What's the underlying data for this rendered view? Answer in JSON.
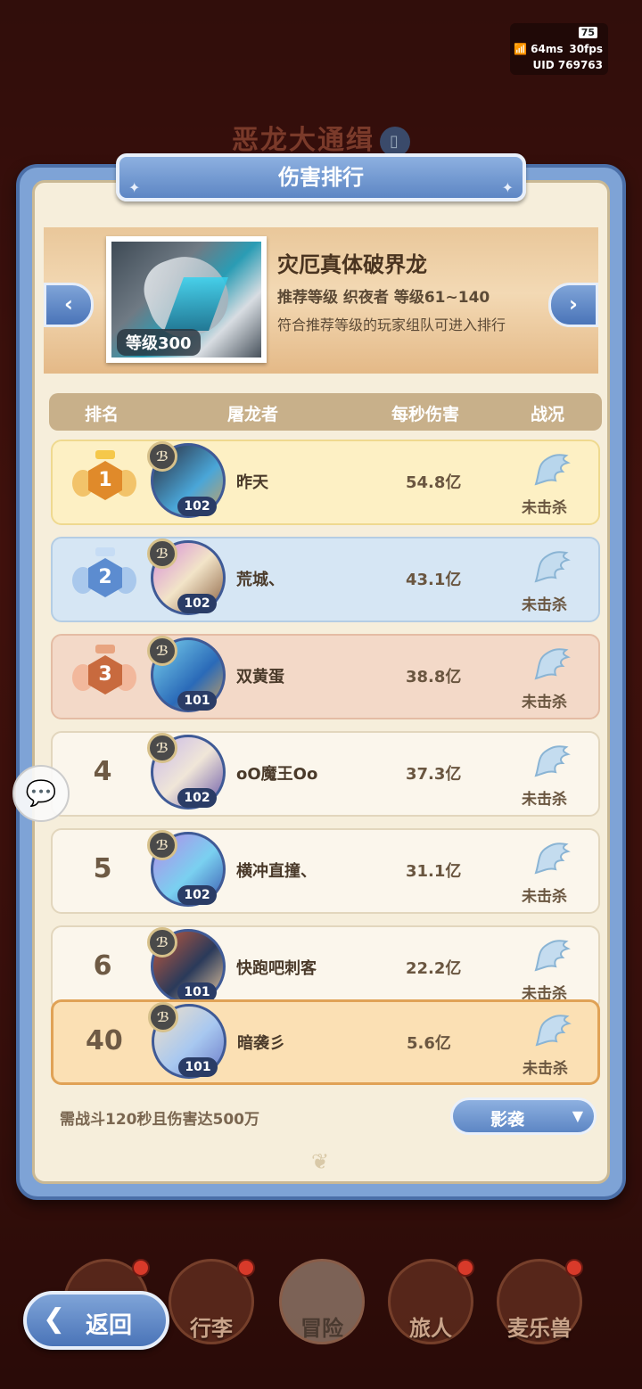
{
  "status": {
    "battery": "75",
    "ping": "64ms",
    "fps": "30fps",
    "uid": "UID 769763"
  },
  "background": {
    "title": "恶龙大通缉"
  },
  "panel": {
    "title": "伤害排行",
    "boss": {
      "name": "灾厄真体破界龙",
      "level": "等级300",
      "recommend": "推荐等级 织夜者 等级61~140",
      "note": "符合推荐等级的玩家组队可进入排行"
    },
    "table_headers": {
      "rank": "排名",
      "player": "屠龙者",
      "dps": "每秒伤害",
      "status": "战况"
    },
    "rows": [
      {
        "rank": "1",
        "name": "昨天",
        "level": "102",
        "dps": "54.8亿",
        "status": "未击杀",
        "tier": "gold"
      },
      {
        "rank": "2",
        "name": "荒城、",
        "level": "102",
        "dps": "43.1亿",
        "status": "未击杀",
        "tier": "silver"
      },
      {
        "rank": "3",
        "name": "双黄蛋",
        "level": "101",
        "dps": "38.8亿",
        "status": "未击杀",
        "tier": "bronze"
      },
      {
        "rank": "4",
        "name": "oO魔王Oo",
        "level": "102",
        "dps": "37.3亿",
        "status": "未击杀",
        "tier": "normal"
      },
      {
        "rank": "5",
        "name": "横冲直撞、",
        "level": "102",
        "dps": "31.1亿",
        "status": "未击杀",
        "tier": "normal"
      },
      {
        "rank": "6",
        "name": "快跑吧刺客",
        "level": "101",
        "dps": "22.2亿",
        "status": "未击杀",
        "tier": "normal"
      }
    ],
    "my_row": {
      "rank": "40",
      "name": "暗袭彡",
      "level": "101",
      "dps": "5.6亿",
      "status": "未击杀"
    },
    "footer_note": "需战斗120秒且伤害达500万",
    "class_filter": "影袭"
  },
  "bottom_nav": [
    {
      "label": "",
      "dot": true
    },
    {
      "label": "行李",
      "dot": true
    },
    {
      "label": "冒险",
      "dot": false,
      "active": true
    },
    {
      "label": "旅人",
      "dot": true
    },
    {
      "label": "麦乐兽",
      "dot": true
    }
  ],
  "back_button": "返回",
  "colors": {
    "panel_blue": "#7ea3d6",
    "parchment": "#f6eedb",
    "gold_row": "#fdf0c4",
    "silver_row": "#d6e6f4",
    "bronze_row": "#f3d9c8",
    "my_row": "#fbe0b4"
  }
}
